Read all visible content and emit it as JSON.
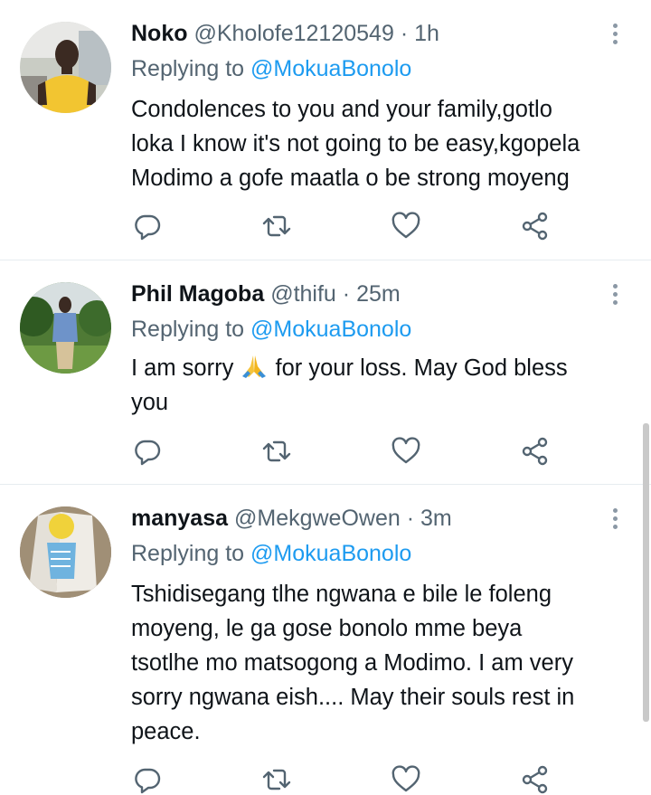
{
  "tweets": [
    {
      "name": "Noko",
      "handle": "@Kholofe12120549",
      "dot": "·",
      "time": "1h",
      "replying_prefix": "Replying to",
      "replying_to": "@MokuaBonolo",
      "lines": [
        "Condolences to you and your family,gotlo",
        "loka I know it's not going to be easy,kgopela",
        "Modimo a gofe maatla  o be strong moyeng"
      ]
    },
    {
      "name": "Phil Magoba",
      "handle": "@thifu",
      "dot": "·",
      "time": "25m",
      "replying_prefix": "Replying to",
      "replying_to": "@MokuaBonolo",
      "line1_a": "I am sorry",
      "emoji": "folded-hands",
      "line1_b": "for your loss. May God bless",
      "line2": "you"
    },
    {
      "name": "manyasa",
      "handle": "@MekgweOwen",
      "dot": "·",
      "time": "3m",
      "replying_prefix": "Replying to",
      "replying_to": "@MokuaBonolo",
      "lines": [
        "Tshidisegang tlhe ngwana e bile le foleng",
        "moyeng, le ga gose bonolo mme beya",
        "tsotlhe mo matsogong a Modimo. I am very",
        "sorry ngwana eish.... May their souls rest in",
        "peace."
      ]
    }
  ],
  "icons": {
    "reply": "reply-icon",
    "retweet": "retweet-icon",
    "like": "heart-icon",
    "share": "share-icon",
    "more": "more-icon"
  },
  "colors": {
    "text": "#0f1419",
    "secondary": "#536471",
    "link": "#1d9bf0",
    "icon": "#536471",
    "divider": "#e6ecf0"
  }
}
